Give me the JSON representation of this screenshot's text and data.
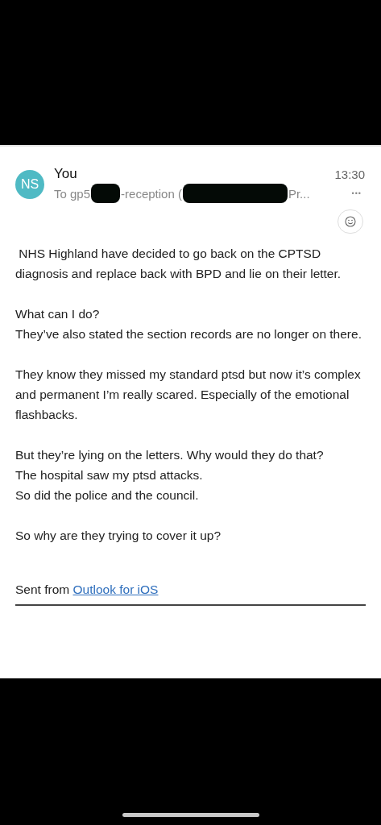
{
  "message": {
    "avatar": {
      "initials": "NS",
      "color": "#4fbac4"
    },
    "sender": "You",
    "time": "13:30",
    "recipient": [
      {
        "kind": "text",
        "text": "To gp5"
      },
      {
        "kind": "redaction"
      },
      {
        "kind": "text",
        "text": "-reception ("
      },
      {
        "kind": "redaction"
      },
      {
        "kind": "text",
        "text": "Pr..."
      }
    ],
    "more": "•••",
    "body": [
      " NHS Highland have decided to go back on the CPTSD diagnosis and replace back with BPD and lie on their letter.",
      "What can I do?\nThey’ve also stated the section records are no longer on there.",
      "They know they missed my standard ptsd but now it’s complex and permanent I’m really scared. Especially of the emotional flashbacks.",
      "But they’re lying on the letters. Why would they do that?\nThe hospital saw my ptsd attacks.\nSo did the police and the council.",
      "So why are they trying to cover it up?"
    ],
    "signature": {
      "text": "Sent from ",
      "link": "Outlook for iOS"
    }
  }
}
